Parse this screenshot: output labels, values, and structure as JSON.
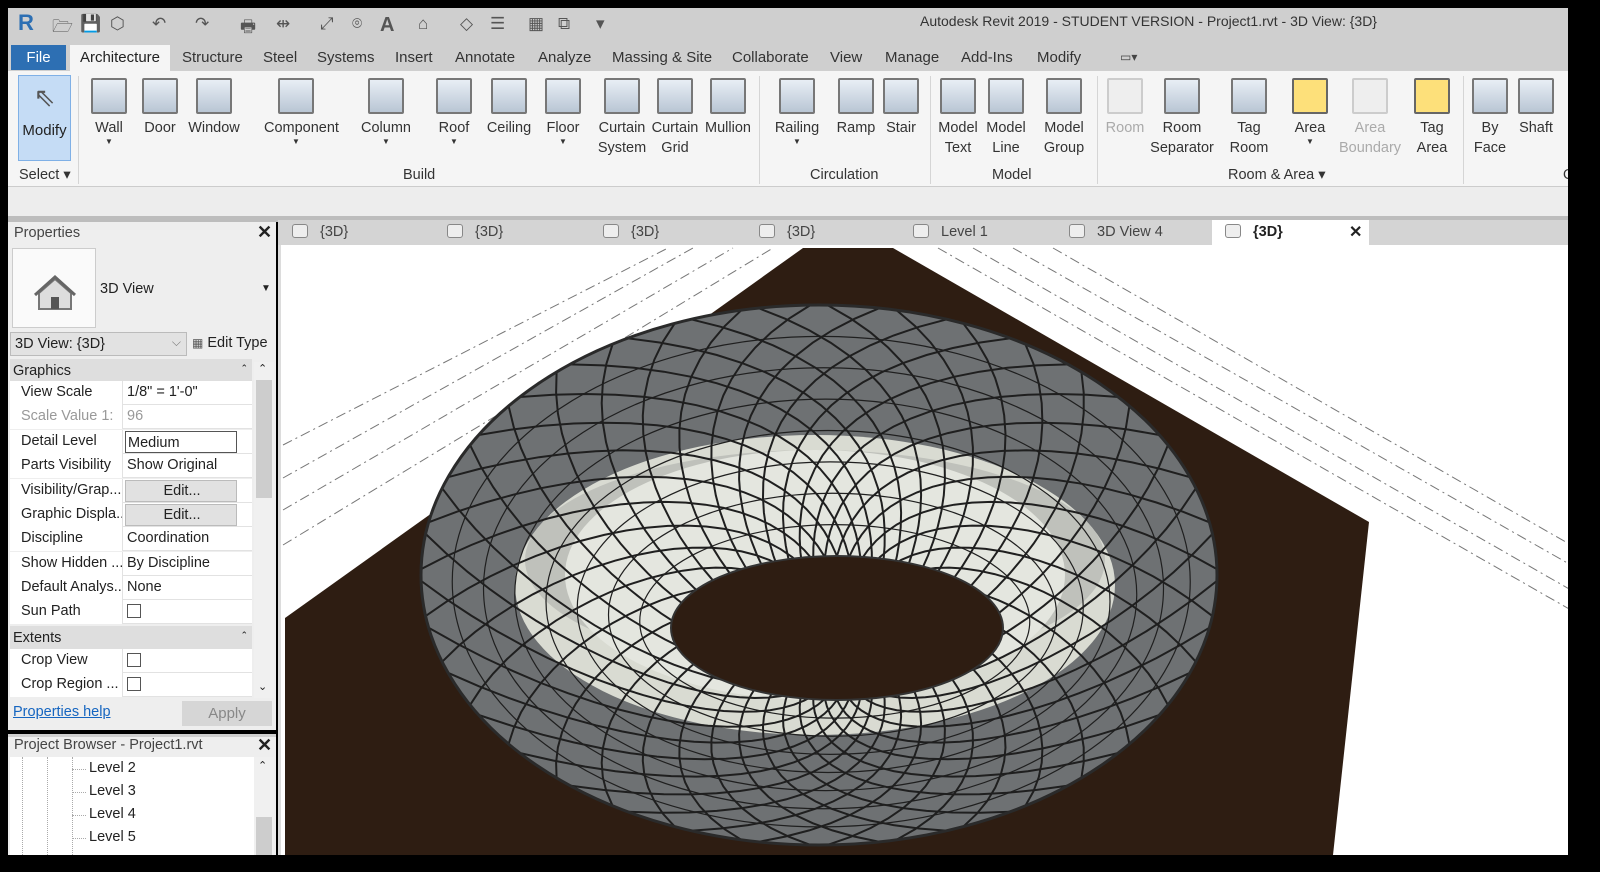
{
  "window": {
    "title": "Autodesk Revit 2019 - STUDENT VERSION - Project1.rvt - 3D View: {3D}"
  },
  "quick_access": [
    "revit-logo",
    "open-icon",
    "save-icon",
    "sync-icon",
    "undo-icon",
    "redo-icon",
    "print-icon",
    "measure-icon",
    "dimension-icon",
    "tag-icon",
    "text-icon",
    "3d-view-icon",
    "section-icon",
    "thin-lines-icon",
    "close-hidden-icon",
    "switch-windows-icon",
    "customize-icon"
  ],
  "menu_tabs": [
    "File",
    "Architecture",
    "Structure",
    "Steel",
    "Systems",
    "Insert",
    "Annotate",
    "Analyze",
    "Massing & Site",
    "Collaborate",
    "View",
    "Manage",
    "Add-Ins",
    "Modify"
  ],
  "ribbon": {
    "modify": "Modify",
    "select": "Select",
    "buttons": [
      {
        "l1": "Wall",
        "dd": true
      },
      {
        "l1": "Door"
      },
      {
        "l1": "Window"
      },
      {
        "l1": "Component",
        "dd": true
      },
      {
        "l1": "Column",
        "dd": true
      },
      {
        "l1": "Roof",
        "dd": true
      },
      {
        "l1": "Ceiling"
      },
      {
        "l1": "Floor",
        "dd": true
      },
      {
        "l1": "Curtain",
        "l2": "System"
      },
      {
        "l1": "Curtain",
        "l2": "Grid"
      },
      {
        "l1": "Mullion"
      },
      {
        "l1": "Railing",
        "dd": true
      },
      {
        "l1": "Ramp"
      },
      {
        "l1": "Stair"
      },
      {
        "l1": "Model",
        "l2": "Text"
      },
      {
        "l1": "Model",
        "l2": "Line"
      },
      {
        "l1": "Model",
        "l2": "Group"
      },
      {
        "l1": "Room",
        "disabled": true
      },
      {
        "l1": "Room",
        "l2": "Separator"
      },
      {
        "l1": "Tag",
        "l2": "Room"
      },
      {
        "l1": "Area",
        "dd": true,
        "yellow": true
      },
      {
        "l1": "Area",
        "l2": "Boundary",
        "disabled": true
      },
      {
        "l1": "Tag",
        "l2": "Area",
        "yellow": true
      },
      {
        "l1": "By",
        "l2": "Face"
      },
      {
        "l1": "Shaft"
      }
    ],
    "panels": [
      "Build",
      "Circulation",
      "Model",
      "Room & Area ▾",
      "O"
    ]
  },
  "properties": {
    "title": "Properties",
    "type_name": "3D View",
    "instance_selector": "3D View: {3D}",
    "edit_type": "Edit Type",
    "sections": {
      "graphics": "Graphics",
      "extents": "Extents"
    },
    "rows": [
      {
        "k": "View Scale",
        "v": "1/8\" = 1'-0\""
      },
      {
        "k": "Scale Value    1:",
        "v": "96"
      },
      {
        "k": "Detail Level",
        "v": "Medium"
      },
      {
        "k": "Parts Visibility",
        "v": "Show Original"
      },
      {
        "k": "Visibility/Grap...",
        "v": "Edit..."
      },
      {
        "k": "Graphic Displa...",
        "v": "Edit..."
      },
      {
        "k": "Discipline",
        "v": "Coordination"
      },
      {
        "k": "Show Hidden ...",
        "v": "By Discipline"
      },
      {
        "k": "Default Analys...",
        "v": "None"
      },
      {
        "k": "Sun Path",
        "v": ""
      },
      {
        "k": "Crop View",
        "v": ""
      },
      {
        "k": "Crop Region ...",
        "v": ""
      }
    ],
    "help": "Properties help",
    "apply": "Apply"
  },
  "project_browser": {
    "title": "Project Browser - Project1.rvt",
    "items": [
      "Level 2",
      "Level 3",
      "Level 4",
      "Level 5"
    ]
  },
  "view_tabs": [
    "{3D}",
    "{3D}",
    "{3D}",
    "{3D}",
    "Level 1",
    "3D View 4",
    "{3D}"
  ],
  "colors": {
    "floor": "#2e1d12",
    "accent": "#2d6fb3",
    "glass": "#6e7173"
  }
}
